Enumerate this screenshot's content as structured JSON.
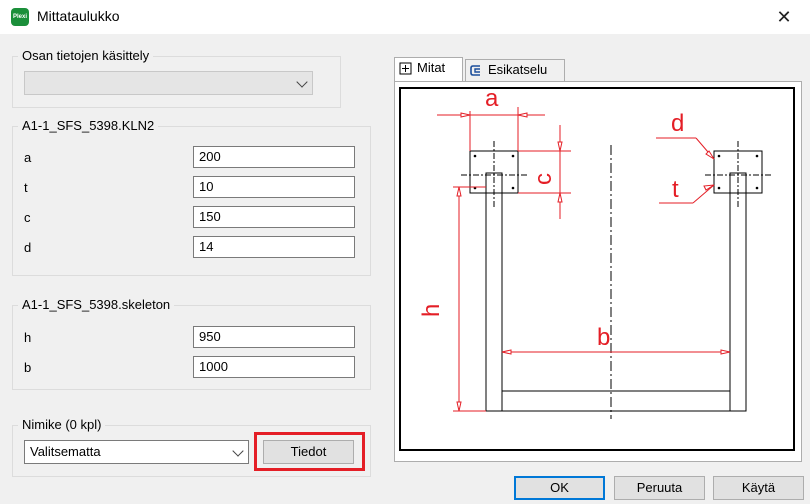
{
  "window": {
    "title": "Mittataulukko",
    "close_label": "✕",
    "app_icon_text": "Plexi"
  },
  "part_handling": {
    "label": "Osan tietojen käsittely",
    "selected_value": ""
  },
  "group_kln2": {
    "label": "A1-1_SFS_5398.KLN2",
    "rows": [
      {
        "label": "a",
        "value": "200"
      },
      {
        "label": "t",
        "value": "10"
      },
      {
        "label": "c",
        "value": "150"
      },
      {
        "label": "d",
        "value": "14"
      }
    ]
  },
  "group_skeleton": {
    "label": "A1-1_SFS_5398.skeleton",
    "rows": [
      {
        "label": "h",
        "value": "950"
      },
      {
        "label": "b",
        "value": "1000"
      }
    ]
  },
  "nimike": {
    "label": "Nimike (0 kpl)",
    "selected_value": "Valitsematta",
    "details_button": "Tiedot"
  },
  "tabs": [
    {
      "label": "Mitat",
      "icon": "dimension-icon"
    },
    {
      "label": "Esikatselu",
      "icon": "preview-icon"
    }
  ],
  "drawing": {
    "labels": {
      "a": "a",
      "c": "c",
      "d": "d",
      "t": "t",
      "h": "h",
      "b": "b"
    },
    "dimension_color": "#e41e26"
  },
  "footer": {
    "ok": "OK",
    "cancel": "Peruuta",
    "apply": "Käytä"
  },
  "colors": {
    "highlight": "#e41e26",
    "focus": "#0078d7"
  }
}
